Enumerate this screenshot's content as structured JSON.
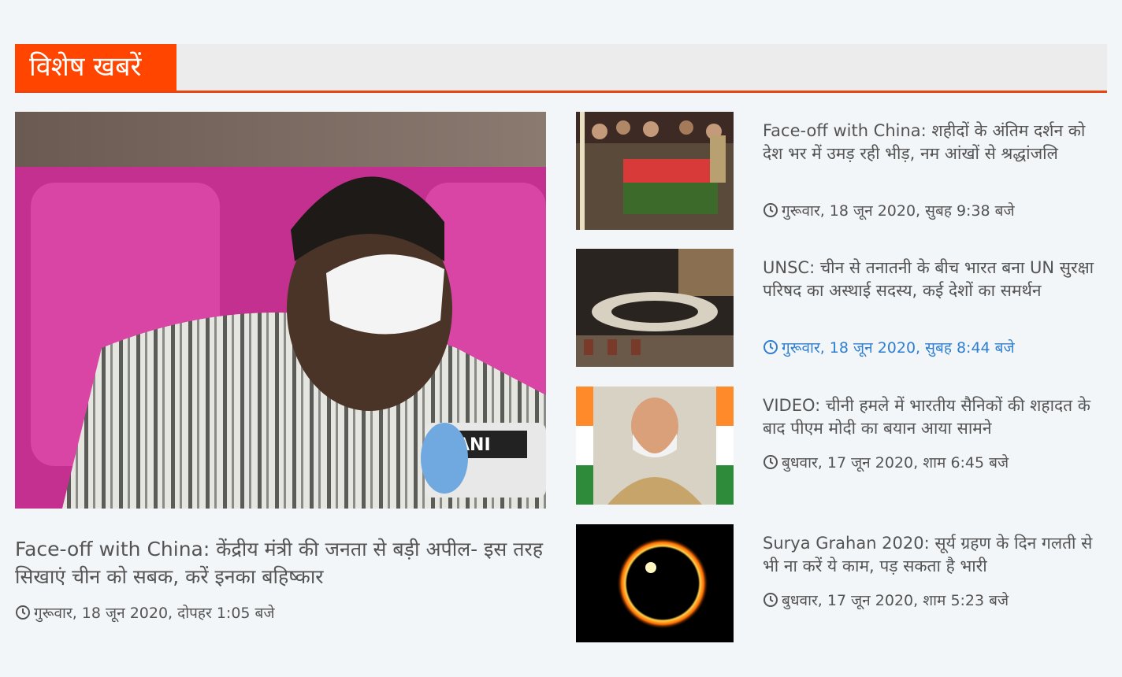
{
  "section": {
    "title": "विशेष खबरें"
  },
  "featured": {
    "headline": "Face-off with China: केंद्रीय मंत्री की जनता से बड़ी अपील- इस तरह सिखाएं चीन को सबक, करें इनका बहिष्कार",
    "time": "गुरूवार, 18 जून 2020, दोपहर 1:05 बजे",
    "icon": "clock-icon"
  },
  "stories": [
    {
      "headline": "Face-off with China: शहीदों के अंतिम दर्शन को देश भर में उमड़ रही भीड़, नम आंखों से श्रद्धांजलि",
      "time": "गुरूवार, 18 जून 2020, सुबह 9:38 बजे"
    },
    {
      "headline": "UNSC: चीन से तनातनी के बीच भारत बना UN सुरक्षा परिषद का अस्थाई सदस्य, कई देशों का समर्थन",
      "time": "गुरूवार, 18 जून 2020, सुबह 8:44 बजे"
    },
    {
      "headline": "VIDEO: चीनी हमले में भारतीय सैनिकों की शहादत के बाद पीएम मोदी का बयान आया सामने",
      "time": "बुधवार, 17 जून 2020, शाम 6:45 बजे"
    },
    {
      "headline": "Surya Grahan 2020: सूर्य ग्रहण के दिन गलती से भी ना करें ये काम, पड़ सकता है भारी",
      "time": "बुधवार, 17 जून 2020, शाम 5:23 बजे"
    }
  ],
  "colors": {
    "accent": "#ff4500",
    "text": "#545454",
    "link_hover": "#2f7fd0",
    "background": "#f3f6f9"
  }
}
